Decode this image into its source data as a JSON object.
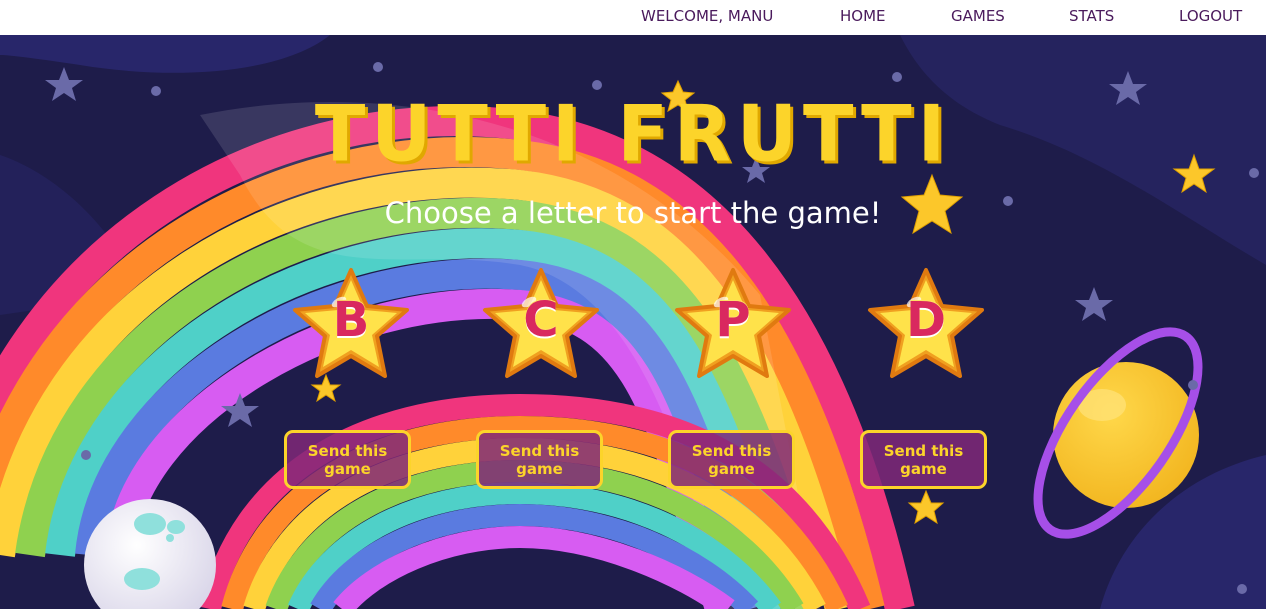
{
  "nav": {
    "welcome": "WELCOME, MANU",
    "home": "HOME",
    "games": "GAMES",
    "stats": "STATS",
    "logout": "LOGOUT"
  },
  "game": {
    "title": "TUTTI FRUTTI",
    "subtitle": "Choose a letter to start the game!"
  },
  "letters": [
    {
      "letter": "B",
      "send_label": "Send this game"
    },
    {
      "letter": "C",
      "send_label": "Send this game"
    },
    {
      "letter": "P",
      "send_label": "Send this game"
    },
    {
      "letter": "D",
      "send_label": "Send this game"
    }
  ],
  "colors": {
    "background": "#1e1c4a",
    "title": "#fcd42a",
    "nav_text": "#4a1a5c",
    "button_fill": "#802878",
    "button_border": "#fcd42a",
    "letter": "#d9285f"
  }
}
